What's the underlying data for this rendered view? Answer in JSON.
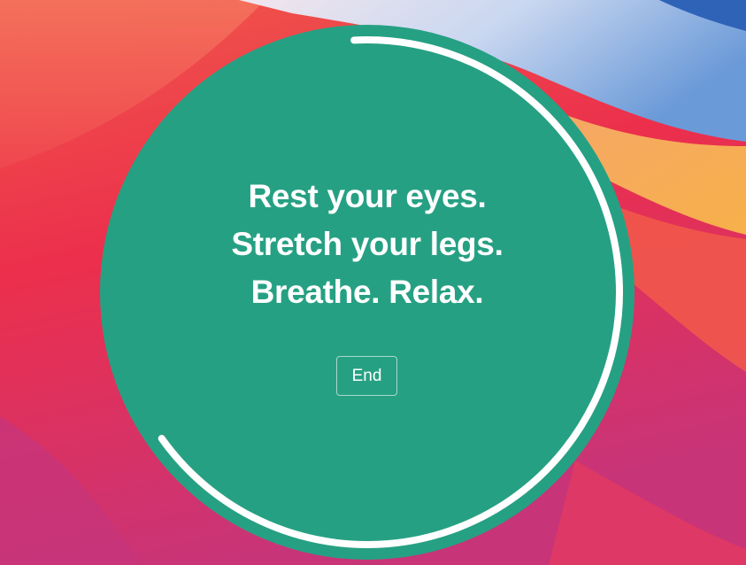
{
  "message": {
    "lines": [
      "Rest your eyes.",
      "Stretch your legs.",
      "Breathe. Relax."
    ]
  },
  "controls": {
    "end_label": "End"
  },
  "break_timer": {
    "progress_fraction": 0.66
  },
  "colors": {
    "circle_fill": "#26a083",
    "text": "#ffffff",
    "progress_ring": "#ffffff"
  }
}
